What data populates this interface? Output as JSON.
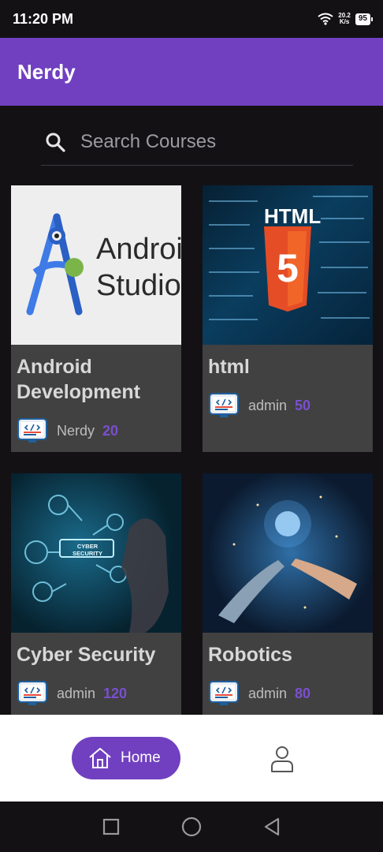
{
  "status_bar": {
    "time": "11:20 PM",
    "net_speed_value": "20.2",
    "net_speed_unit": "K/s",
    "battery": "95"
  },
  "app_bar": {
    "title": "Nerdy"
  },
  "search": {
    "placeholder": "Search Courses"
  },
  "courses": [
    {
      "title": "Android Development",
      "author": "Nerdy",
      "count": "20",
      "image": "android-studio-logo",
      "image_text": [
        "Android",
        "Studio"
      ]
    },
    {
      "title": "html",
      "author": "admin",
      "count": "50",
      "image": "html5-code-background",
      "image_text": [
        "HTML",
        "5"
      ]
    },
    {
      "title": "Cyber Security",
      "author": "admin",
      "count": "120",
      "image": "cyber-security-hand",
      "image_text": [
        "CYBER SECURITY"
      ]
    },
    {
      "title": "Robotics",
      "author": "admin",
      "count": "80",
      "image": "robot-human-hands",
      "image_text": []
    }
  ],
  "bottom_nav": {
    "home_label": "Home",
    "profile_icon": "person-icon",
    "home_icon": "house-icon"
  },
  "colors": {
    "accent": "#7040c0",
    "count": "#7a4fd1",
    "card_bg": "#414141",
    "page_bg": "#141115"
  }
}
